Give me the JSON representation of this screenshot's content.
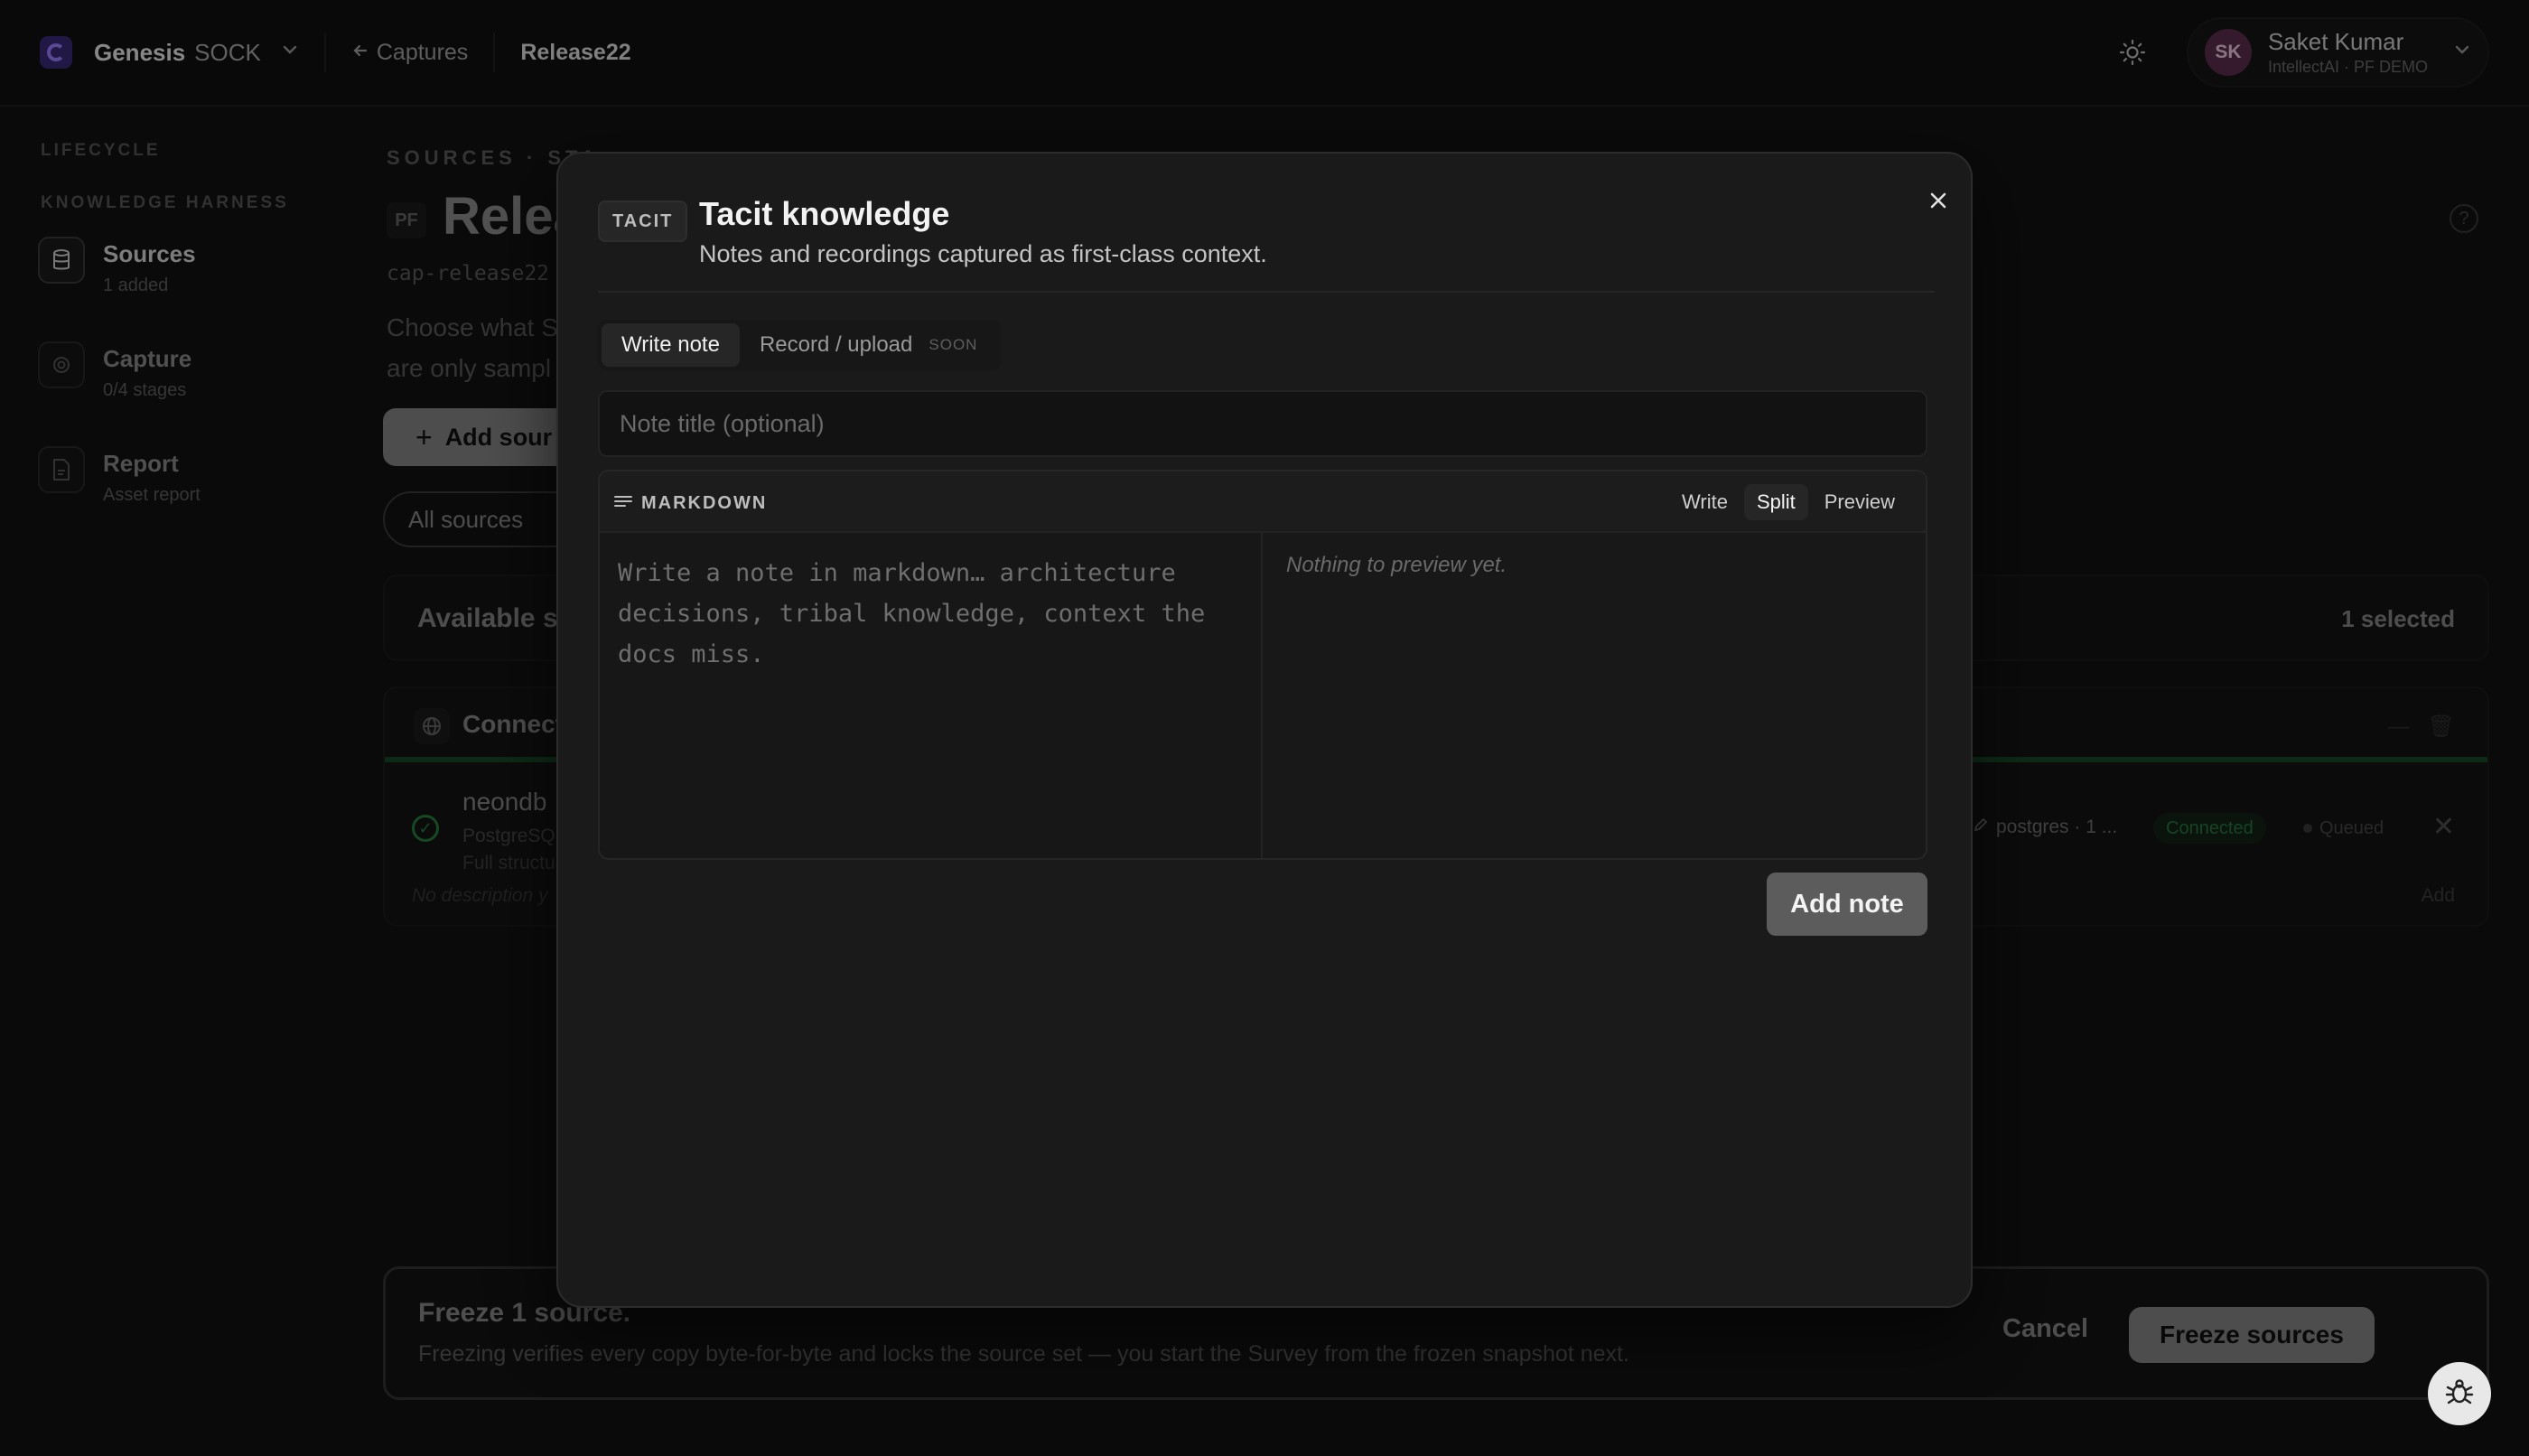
{
  "topbar": {
    "brand": "Genesis",
    "brand_sub": "SOCK",
    "back_label": "Captures",
    "current_crumb": "Release22",
    "user": {
      "initials": "SK",
      "name": "Saket Kumar",
      "org": "IntellectAI · PF DEMO"
    }
  },
  "sidebar": {
    "caption_lifecycle": "LIFECYCLE",
    "caption_harness": "KNOWLEDGE HARNESS",
    "items": [
      {
        "title": "Sources",
        "sub": "1 added"
      },
      {
        "title": "Capture",
        "sub": "0/4 stages"
      },
      {
        "title": "Report",
        "sub": "Asset report"
      }
    ]
  },
  "main": {
    "eyebrow": "SOURCES · STA",
    "pf_badge": "PF",
    "title": "Relea",
    "cap_id": "cap-release22",
    "lead_line1": "Choose what S",
    "lead_line2": "are only sampl",
    "add_source": "Add sour",
    "all_sources": "All sources",
    "available_title": "Available s",
    "selected_count": "1 selected",
    "connected_title": "Connect",
    "row": {
      "name": "neondb",
      "type": "PostgreSQ",
      "struct": "Full structu",
      "desc": "No description y",
      "conn": "postgres · 1 ...",
      "status": "Connected",
      "queue": "Queued",
      "add": "Add"
    }
  },
  "freeze": {
    "title": "Freeze 1 source.",
    "desc": "Freezing verifies every copy byte-for-byte and locks the source set — you start the Survey from the frozen snapshot next.",
    "cancel": "Cancel",
    "confirm": "Freeze sources"
  },
  "modal": {
    "badge": "TACIT",
    "title": "Tacit knowledge",
    "subtitle": "Notes and recordings captured as first-class context.",
    "tabs": {
      "write": "Write note",
      "record": "Record / upload",
      "soon": "SOON"
    },
    "title_placeholder": "Note title (optional)",
    "editor_label": "MARKDOWN",
    "modes": {
      "write": "Write",
      "split": "Split",
      "preview": "Preview"
    },
    "body_placeholder": "Write a note in markdown… architecture decisions, tribal knowledge, context the docs miss.",
    "preview_empty": "Nothing to preview yet.",
    "add_button": "Add note"
  },
  "colors": {
    "accent_green": "#34c25a",
    "brand_purple": "#9a7cff"
  }
}
